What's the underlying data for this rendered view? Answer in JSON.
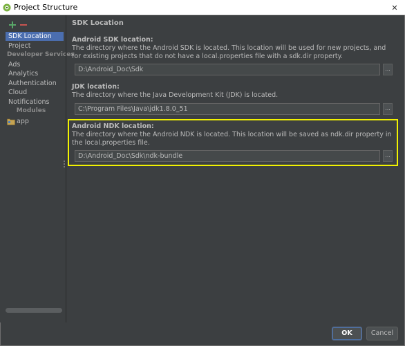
{
  "window": {
    "title": "Project Structure",
    "close_glyph": "✕"
  },
  "sidebar": {
    "add_glyph": "+",
    "remove_glyph": "−",
    "items": [
      {
        "label": "SDK Location",
        "selected": true
      },
      {
        "label": "Project"
      }
    ],
    "developer_services_header": "Developer Services",
    "services": [
      {
        "label": "Ads"
      },
      {
        "label": "Analytics"
      },
      {
        "label": "Authentication"
      },
      {
        "label": "Cloud"
      },
      {
        "label": "Notifications"
      }
    ],
    "modules_header": "Modules",
    "modules": [
      {
        "label": "app",
        "icon": "folder-icon"
      }
    ]
  },
  "main": {
    "section_title": "SDK Location",
    "android_sdk": {
      "label": "Android SDK location:",
      "description": "The directory where the Android SDK is located. This location will be used for new projects, and for existing projects that do not have a local.properties file with a sdk.dir property.",
      "value": "D:\\Android_Doc\\Sdk",
      "browse": "..."
    },
    "jdk": {
      "label": "JDK location:",
      "description": "The directory where the Java Development Kit (JDK) is located.",
      "value": "C:\\Program Files\\Java\\jdk1.8.0_51",
      "browse": "..."
    },
    "android_ndk": {
      "label": "Android NDK location:",
      "description": "The directory where the Android NDK is located. This location will be saved as ndk.dir property in the local.properties file.",
      "value": "D:\\Android_Doc\\Sdk\\ndk-bundle",
      "browse": "..."
    }
  },
  "footer": {
    "ok_label": "OK",
    "cancel_label": "Cancel"
  },
  "colors": {
    "background": "#3c3f41",
    "selection": "#4b6eaf",
    "highlight_border": "#f2f200",
    "field_background": "#45494a"
  }
}
